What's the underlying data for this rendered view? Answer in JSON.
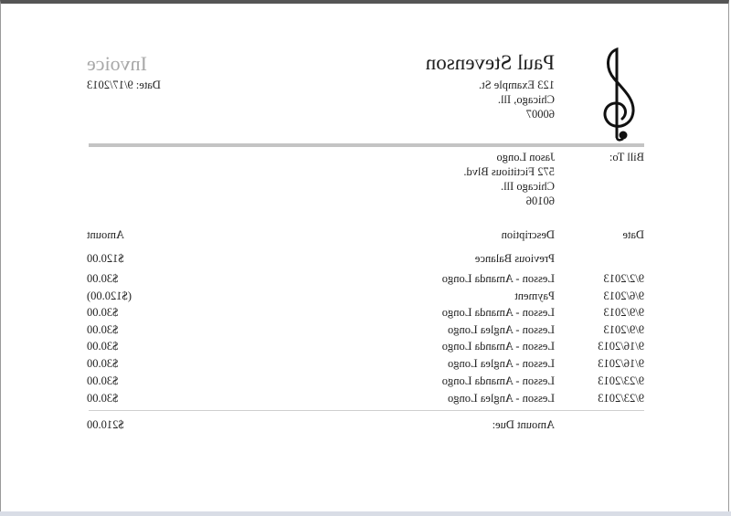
{
  "sender": {
    "name": "Paul Stevenson",
    "address_lines": [
      "123 Example St.",
      "Chicago, Ill.",
      "60007"
    ]
  },
  "invoice": {
    "title": "Invoice",
    "date_label": "Date:",
    "date": "9/17/2013",
    "date_text": "Date: 9/17/2013"
  },
  "bill_to": {
    "label": "Bill To:",
    "lines": [
      "Jason Longo",
      "572 Fictitious Blvd.",
      "Chicago Ill.",
      "60106"
    ]
  },
  "table": {
    "headers": {
      "date": "Date",
      "description": "Description",
      "amount": "Amount"
    },
    "previous_balance": {
      "description": "Previous Balance",
      "amount": "$120.00"
    },
    "rows": [
      {
        "date": "9/2/2013",
        "description": "Lesson - Amanda Longo",
        "amount": "$30.00"
      },
      {
        "date": "9/6/2013",
        "description": "Payment",
        "amount": "($120.00)"
      },
      {
        "date": "9/9/2013",
        "description": "Lesson - Amanda Longo",
        "amount": "$30.00"
      },
      {
        "date": "9/9/2013",
        "description": "Lesson - Anglea Longo",
        "amount": "$30.00"
      },
      {
        "date": "9/16/2013",
        "description": "Lesson - Amanda Longo",
        "amount": "$30.00"
      },
      {
        "date": "9/16/2013",
        "description": "Lesson - Anglea Longo",
        "amount": "$30.00"
      },
      {
        "date": "9/23/2013",
        "description": "Lesson - Amanda Longo",
        "amount": "$30.00"
      },
      {
        "date": "9/23/2013",
        "description": "Lesson - Anglea Longo",
        "amount": "$30.00"
      }
    ],
    "amount_due": {
      "label": "Amount Due:",
      "amount": "$210.00"
    }
  },
  "icons": {
    "logo": "treble-clef-icon"
  },
  "colors": {
    "title_gray": "#a8a8a8",
    "rule_gray": "#c4c4c4"
  }
}
